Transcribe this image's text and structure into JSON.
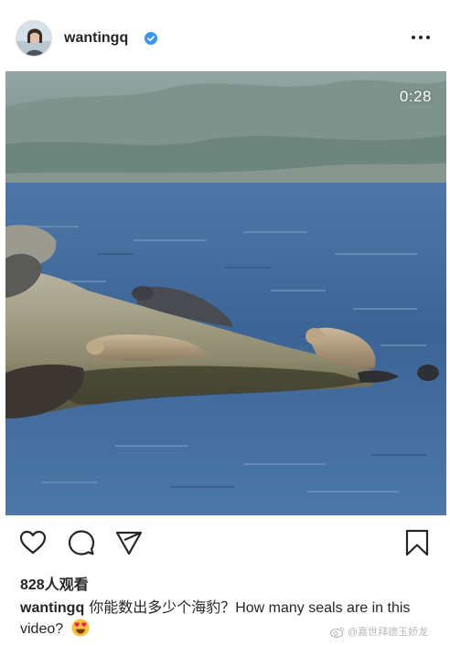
{
  "post": {
    "username": "wantingq",
    "video_duration": "0:28",
    "views": "828人观看",
    "caption_user": "wantingq",
    "caption_text": "你能数出多少个海豹？How many seals are in this video?"
  },
  "icons": {
    "verified": "verified-badge-icon",
    "more": "more-options-icon",
    "like": "heart-icon",
    "comment": "comment-bubble-icon",
    "share": "paper-plane-icon",
    "save": "bookmark-icon",
    "emoji": "heart-eyes-emoji-icon"
  },
  "watermark": {
    "text": "@嘉世拜德玉娇龙"
  },
  "colors": {
    "verified": "#3897f0",
    "text": "#262626",
    "emoji": "#f7c03a",
    "emoji_hearts": "#e0245e"
  }
}
